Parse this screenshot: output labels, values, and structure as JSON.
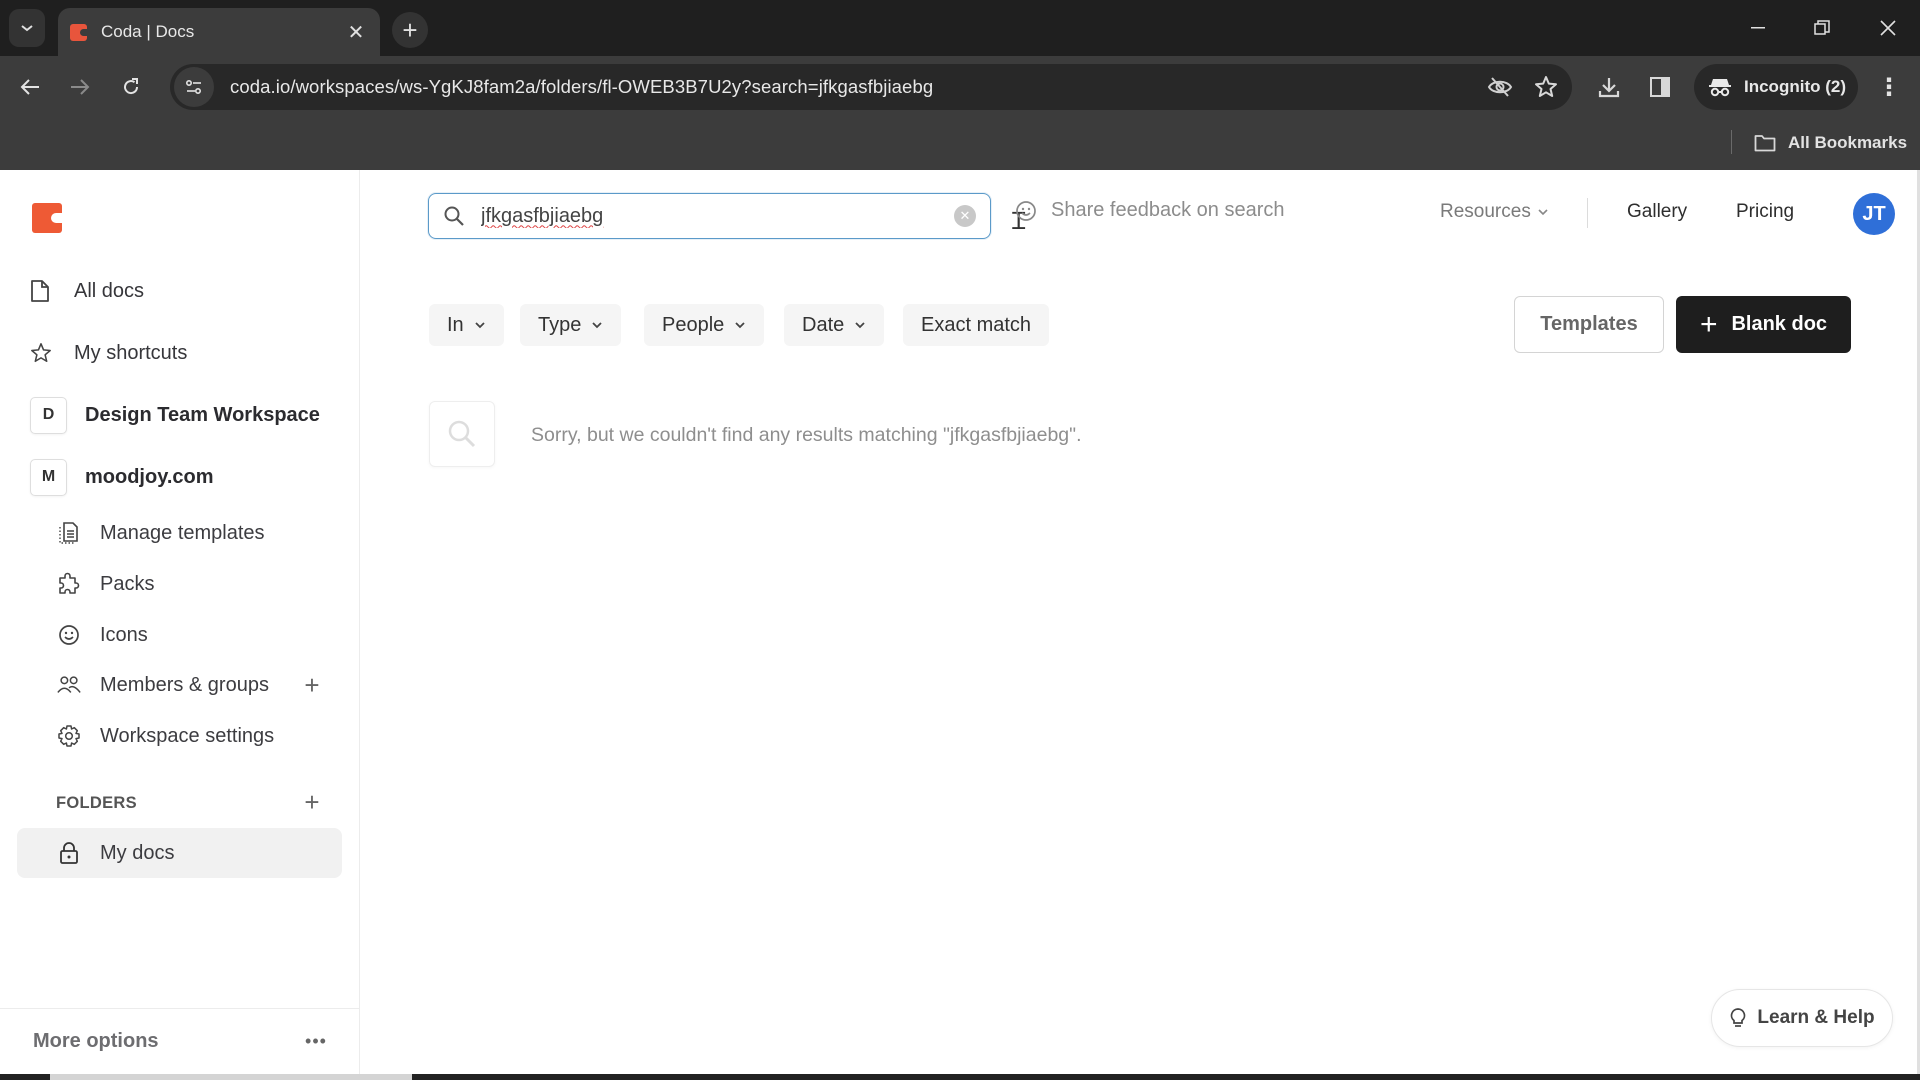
{
  "browser": {
    "tab_title": "Coda | Docs",
    "url": "coda.io/workspaces/ws-YgKJ8fam2a/folders/fl-OWEB3B7U2y?search=jfkgasfbjiaebg",
    "incognito_label": "Incognito (2)",
    "bookmarks_label": "All Bookmarks",
    "tab_close_glyph": "✕",
    "new_tab_glyph": "+",
    "minimize_glyph": "—",
    "restore_glyph": "❐",
    "close_glyph": "✕",
    "back_glyph": "←",
    "forward_glyph": "→",
    "reload_glyph": "↻",
    "menu_glyph": "⋮"
  },
  "sidebar": {
    "top_items": [
      {
        "label": "All docs",
        "icon": "document-icon"
      },
      {
        "label": "My shortcuts",
        "icon": "star-icon"
      }
    ],
    "workspaces": [
      {
        "badge": "D",
        "label": "Design Team Workspace"
      },
      {
        "badge": "M",
        "label": "moodjoy.com"
      }
    ],
    "workspace_items": [
      {
        "label": "Manage templates",
        "icon": "template-icon"
      },
      {
        "label": "Packs",
        "icon": "puzzle-icon"
      },
      {
        "label": "Icons",
        "icon": "smiley-icon"
      },
      {
        "label": "Members & groups",
        "icon": "people-icon"
      },
      {
        "label": "Workspace settings",
        "icon": "gear-icon"
      }
    ],
    "folders_label": "FOLDERS",
    "folders": [
      {
        "label": "My docs",
        "icon": "lock-icon",
        "selected": true
      }
    ],
    "more_options_label": "More options",
    "more_glyph": "•••",
    "plus_glyph": "+"
  },
  "header": {
    "search": {
      "value": "jfkgasfbjiaebg",
      "placeholder": ""
    },
    "feedback_label": "Share feedback on search",
    "resources_label": "Resources",
    "gallery_label": "Gallery",
    "pricing_label": "Pricing",
    "avatar_initials": "JT",
    "avatar_color": "#2f6fd8"
  },
  "filters": [
    {
      "label": "In",
      "dropdown": true
    },
    {
      "label": "Type",
      "dropdown": true
    },
    {
      "label": "People",
      "dropdown": true
    },
    {
      "label": "Date",
      "dropdown": true
    },
    {
      "label": "Exact match",
      "dropdown": false
    }
  ],
  "actions": {
    "templates_label": "Templates",
    "blank_doc_label": "Blank doc",
    "blank_doc_glyph": "+"
  },
  "results": {
    "empty_message": "Sorry, but we couldn't find any results matching \"jfkgasfbjiaebg\"."
  },
  "help": {
    "learn_help_label": "Learn & Help"
  },
  "colors": {
    "brand": "#ee5a35",
    "primary_button": "#1e1e1e",
    "search_focus": "#5b9ac9"
  }
}
